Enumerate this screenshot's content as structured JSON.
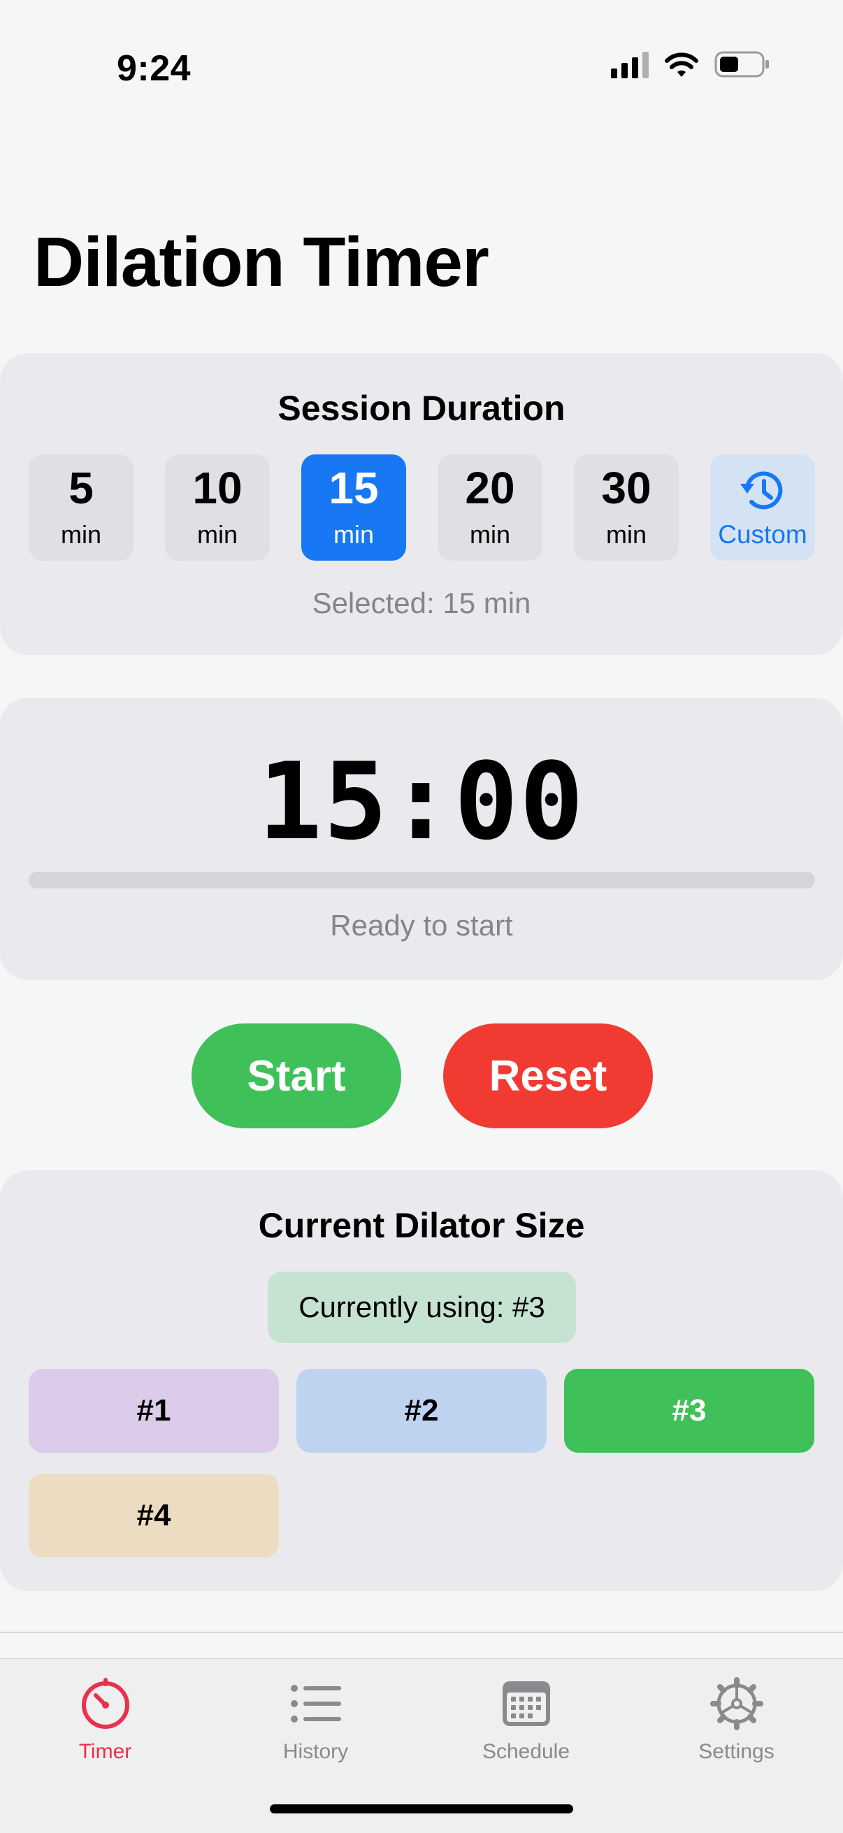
{
  "status_bar": {
    "time": "9:24"
  },
  "page_title": "Dilation Timer",
  "duration": {
    "heading": "Session Duration",
    "options": [
      {
        "value": "5",
        "unit": "min"
      },
      {
        "value": "10",
        "unit": "min"
      },
      {
        "value": "15",
        "unit": "min"
      },
      {
        "value": "20",
        "unit": "min"
      },
      {
        "value": "30",
        "unit": "min"
      }
    ],
    "custom_label": "Custom",
    "selected_index": 2,
    "selected_text": "Selected: 15 min"
  },
  "timer": {
    "display": "15:00",
    "progress": 0,
    "status": "Ready to start"
  },
  "controls": {
    "start_label": "Start",
    "reset_label": "Reset"
  },
  "dilator": {
    "heading": "Current Dilator Size",
    "current_text": "Currently using: #3",
    "sizes": [
      {
        "label": "#1",
        "color": "#ddcbea"
      },
      {
        "label": "#2",
        "color": "#bed3ef"
      },
      {
        "label": "#3",
        "color": "#40c059"
      },
      {
        "label": "#4",
        "color": "#ecdcc2"
      }
    ],
    "selected_index": 2
  },
  "tabs": [
    {
      "label": "Timer",
      "icon": "timer-icon"
    },
    {
      "label": "History",
      "icon": "list-icon"
    },
    {
      "label": "Schedule",
      "icon": "calendar-icon"
    },
    {
      "label": "Settings",
      "icon": "gear-icon"
    }
  ],
  "active_tab_index": 0,
  "colors": {
    "accent": "#1877f2",
    "start": "#40c059",
    "reset": "#f03a32",
    "active_tab": "#e8314f"
  }
}
